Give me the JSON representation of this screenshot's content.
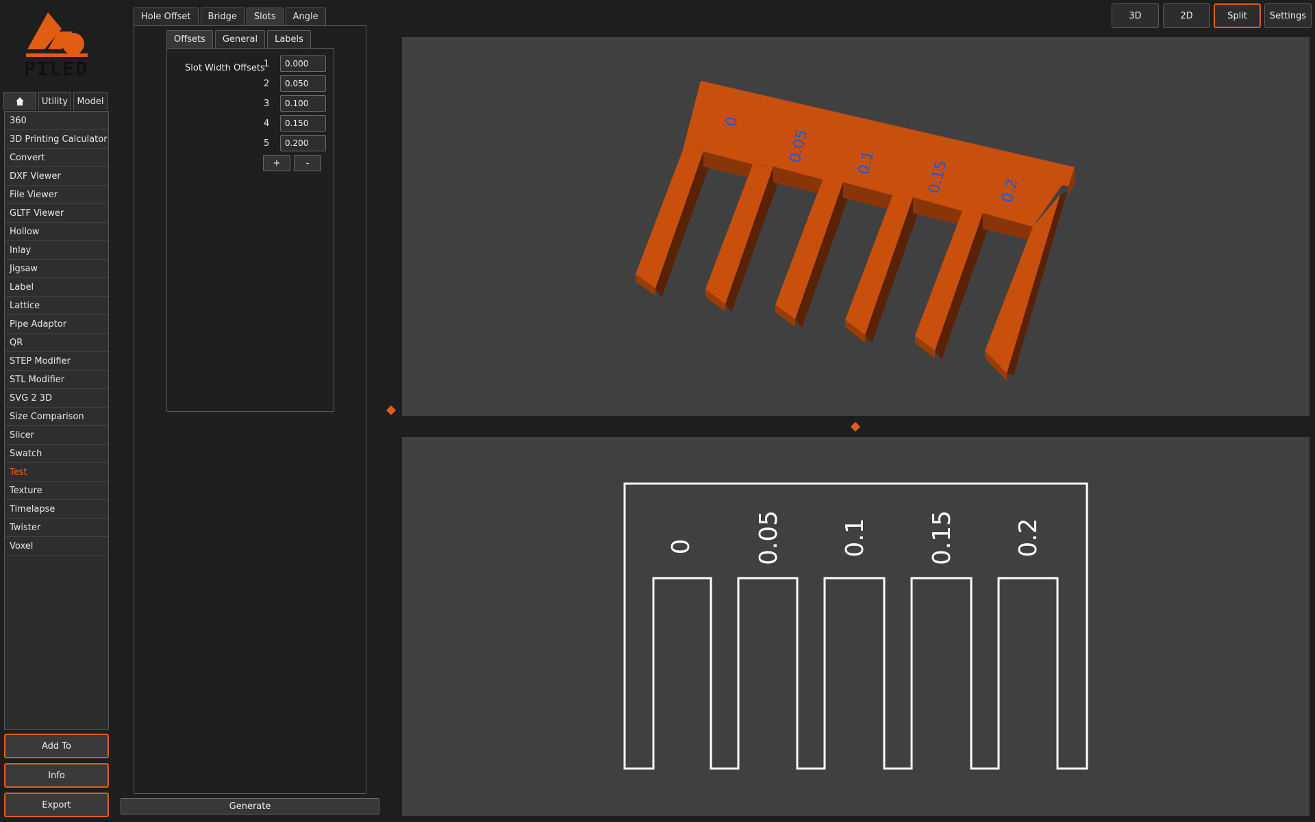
{
  "app": {
    "logo_text": "PILED",
    "accent": "#e35c14"
  },
  "nav_tabs": [
    {
      "label": "",
      "icon": "home-icon"
    },
    {
      "label": "Utility"
    },
    {
      "label": "Model"
    }
  ],
  "tools": [
    "360",
    "3D Printing Calculator",
    "Convert",
    "DXF Viewer",
    "File Viewer",
    "GLTF Viewer",
    "Hollow",
    "Inlay",
    "Jigsaw",
    "Label",
    "Lattice",
    "Pipe Adaptor",
    "QR",
    "STEP Modifier",
    "STL Modifier",
    "SVG 2 3D",
    "Size Comparison",
    "Slicer",
    "Swatch",
    "Test",
    "Texture",
    "Timelapse",
    "Twister",
    "Voxel"
  ],
  "active_tool": "Test",
  "side_buttons": {
    "add_to": "Add To",
    "info": "Info",
    "export": "Export"
  },
  "test_tabs": [
    "Hole Offset",
    "Bridge",
    "Slots",
    "Angle"
  ],
  "active_test_tab": "Slots",
  "sub_tabs": [
    "Offsets",
    "General",
    "Labels"
  ],
  "active_sub_tab": "Offsets",
  "offsets": {
    "label": "Slot Width Offsets",
    "rows": [
      {
        "index": "1",
        "value": "0.000"
      },
      {
        "index": "2",
        "value": "0.050"
      },
      {
        "index": "3",
        "value": "0.100"
      },
      {
        "index": "4",
        "value": "0.150"
      },
      {
        "index": "5",
        "value": "0.200"
      }
    ],
    "add_label": "+",
    "remove_label": "-"
  },
  "generate_label": "Generate",
  "view_modes": [
    "3D",
    "2D",
    "Split"
  ],
  "active_view_mode": "Split",
  "settings_label": "Settings",
  "model_labels": [
    "0",
    "0.05",
    "0.1",
    "0.15",
    "0.2"
  ],
  "colors": {
    "model_fill": "#c84f0c",
    "model_shadow": "#5a2204",
    "label_blue": "#1c5ae0",
    "viewport": "#404040"
  }
}
